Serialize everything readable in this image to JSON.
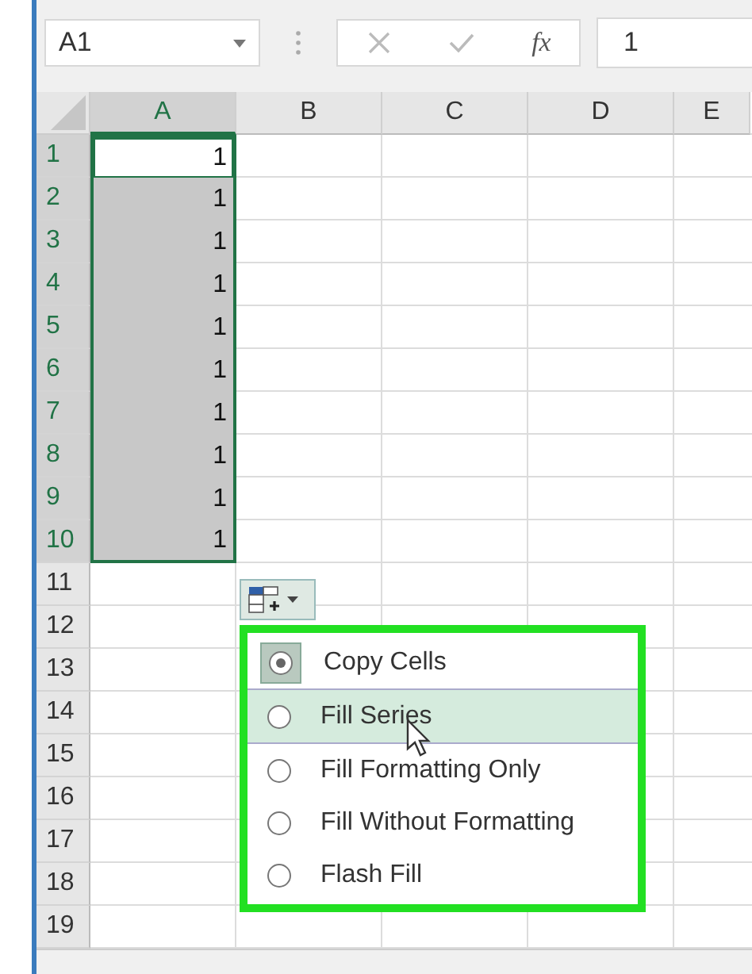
{
  "name_box": {
    "value": "A1"
  },
  "formula_bar": {
    "function_label": "fx",
    "value": "1"
  },
  "columns": [
    {
      "label": "A",
      "selected": true
    },
    {
      "label": "B",
      "selected": false
    },
    {
      "label": "C",
      "selected": false
    },
    {
      "label": "D",
      "selected": false
    },
    {
      "label": "E",
      "selected": false
    }
  ],
  "rows": [
    {
      "label": "1",
      "value": "1",
      "highlighted": true,
      "active": true
    },
    {
      "label": "2",
      "value": "1",
      "highlighted": true,
      "active": false
    },
    {
      "label": "3",
      "value": "1",
      "highlighted": true,
      "active": false
    },
    {
      "label": "4",
      "value": "1",
      "highlighted": true,
      "active": false
    },
    {
      "label": "5",
      "value": "1",
      "highlighted": true,
      "active": false
    },
    {
      "label": "6",
      "value": "1",
      "highlighted": true,
      "active": false
    },
    {
      "label": "7",
      "value": "1",
      "highlighted": true,
      "active": false
    },
    {
      "label": "8",
      "value": "1",
      "highlighted": true,
      "active": false
    },
    {
      "label": "9",
      "value": "1",
      "highlighted": true,
      "active": false
    },
    {
      "label": "10",
      "value": "1",
      "highlighted": true,
      "active": false
    },
    {
      "label": "11",
      "highlighted": false,
      "active": false
    },
    {
      "label": "12",
      "highlighted": false,
      "active": false
    },
    {
      "label": "13",
      "highlighted": false,
      "active": false
    },
    {
      "label": "14",
      "highlighted": false,
      "active": false
    },
    {
      "label": "15",
      "highlighted": false,
      "active": false
    },
    {
      "label": "16",
      "highlighted": false,
      "active": false
    },
    {
      "label": "17",
      "highlighted": false,
      "active": false
    },
    {
      "label": "18",
      "highlighted": false,
      "active": false
    },
    {
      "label": "19",
      "highlighted": false,
      "active": false
    }
  ],
  "autofill_menu": {
    "items": [
      {
        "label": "Copy Cells",
        "checked": true,
        "hovered": false
      },
      {
        "label": "Fill Series",
        "checked": false,
        "hovered": true
      },
      {
        "label": "Fill Formatting Only",
        "checked": false,
        "hovered": false
      },
      {
        "label": "Fill Without Formatting",
        "checked": false,
        "hovered": false
      },
      {
        "label": "Flash Fill",
        "checked": false,
        "hovered": false
      }
    ]
  }
}
